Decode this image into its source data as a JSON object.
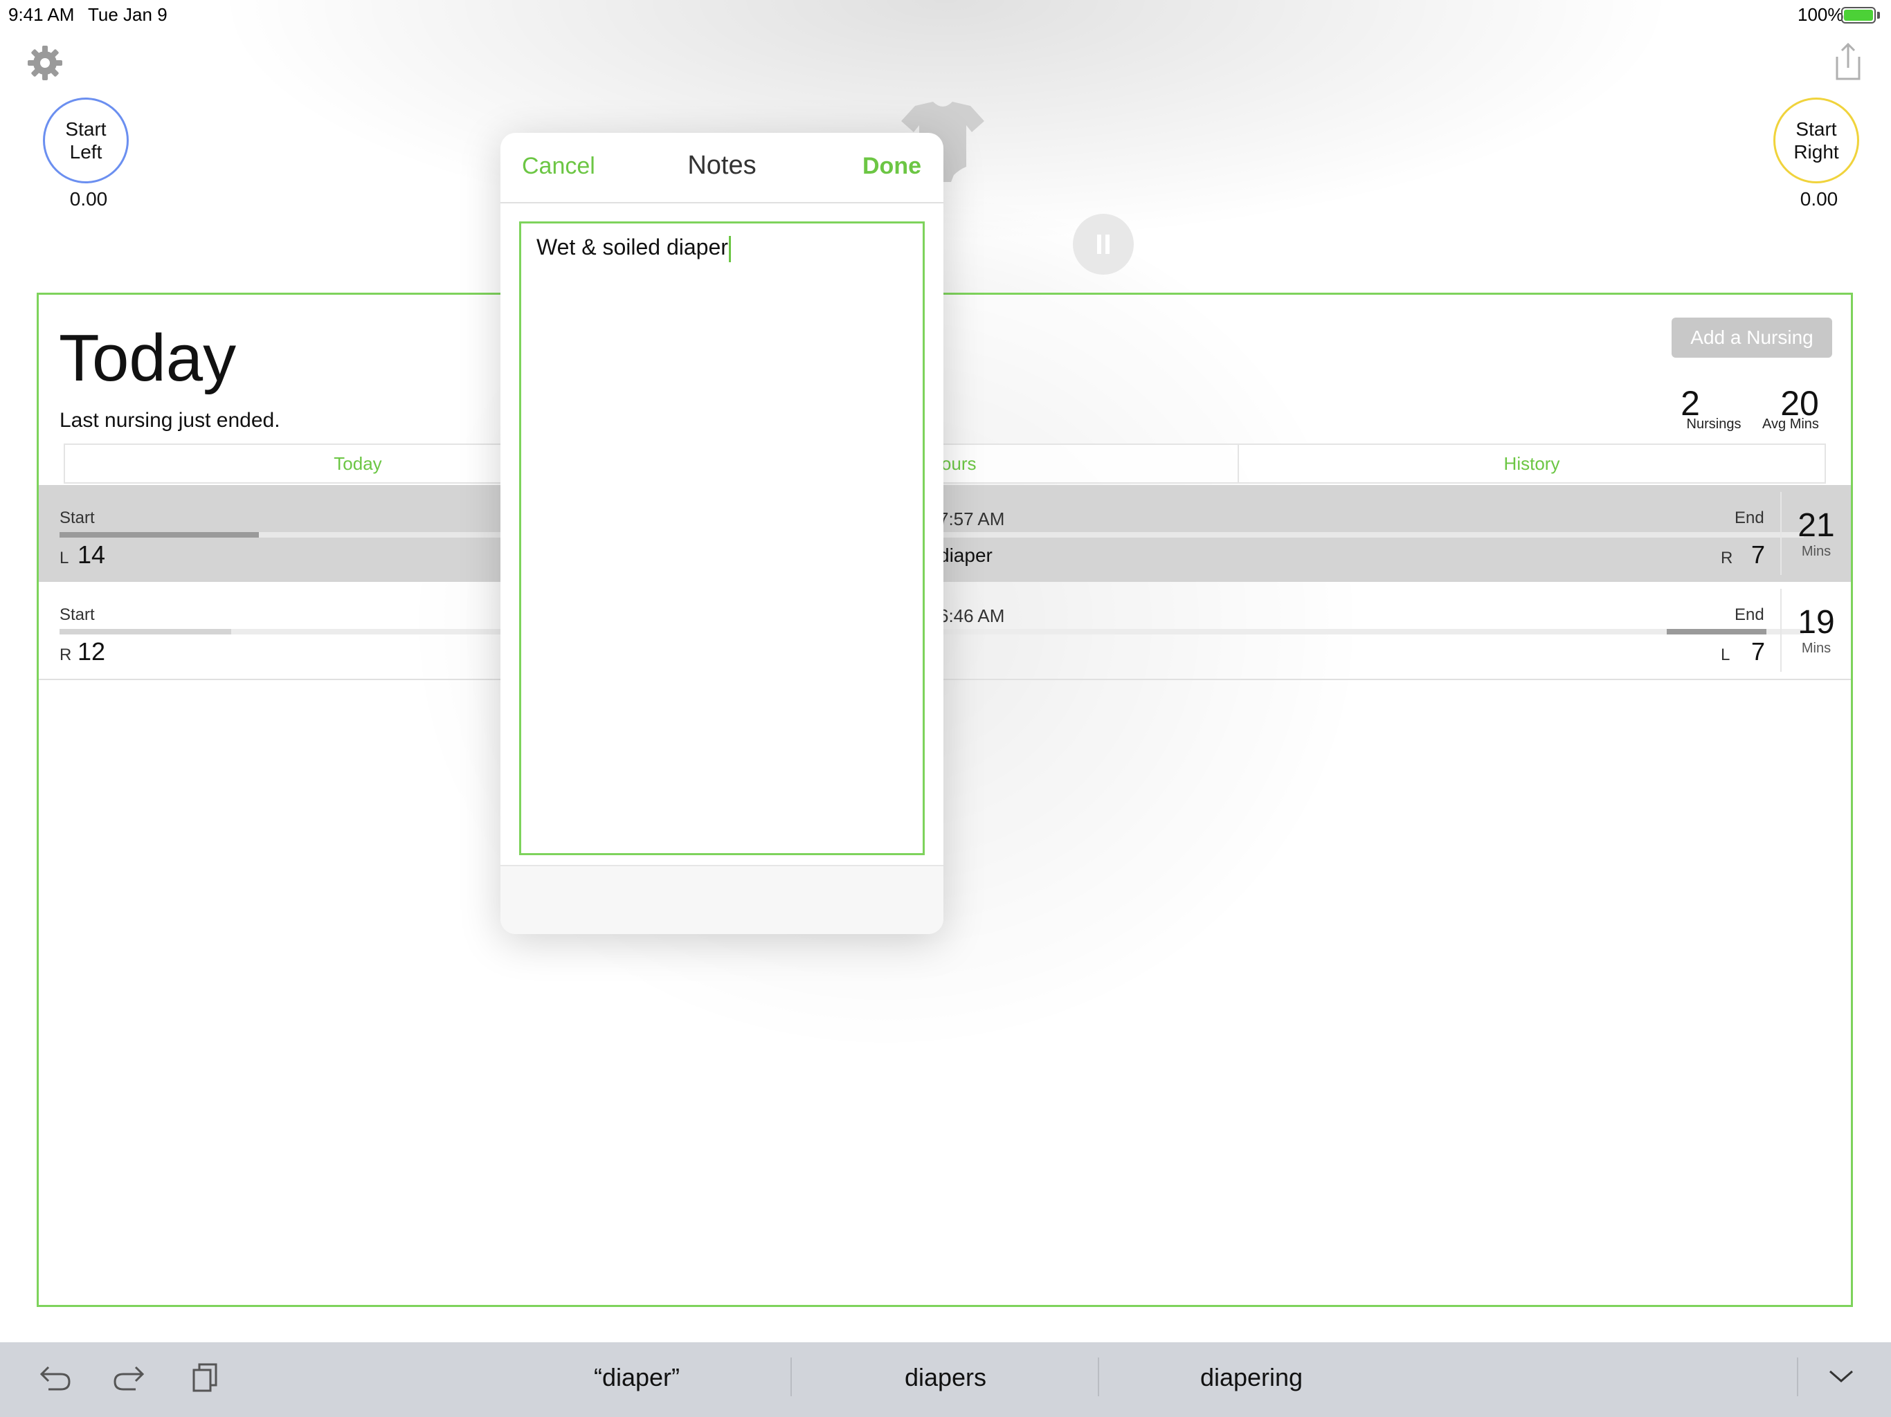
{
  "status_bar": {
    "time": "9:41 AM",
    "date": "Tue Jan 9",
    "battery": "100%"
  },
  "timers": {
    "left": {
      "line1": "Start",
      "line2": "Left",
      "elapsed": "0.00",
      "color": "#6b8ff0"
    },
    "right": {
      "line1": "Start",
      "line2": "Right",
      "elapsed": "0.00",
      "color": "#f0d33c"
    }
  },
  "summary": {
    "title": "Today",
    "subtitle": "Last nursing just ended.",
    "add_button": "Add a Nursing",
    "nursings_count": "2",
    "nursings_label": "Nursings",
    "avg_mins": "20",
    "avg_label": "Avg Mins"
  },
  "tabs": [
    {
      "label": "Today"
    },
    {
      "label": "4 Hours"
    },
    {
      "label": "History"
    }
  ],
  "sessions": [
    {
      "start_label": "Start",
      "start_side": "L",
      "start_mins": "14",
      "time": "7:57 AM",
      "note": "diaper",
      "end_label": "End",
      "end_side": "R",
      "end_mins": "7",
      "total": "21",
      "total_label": "Mins",
      "progress": 0.22
    },
    {
      "start_label": "Start",
      "start_side": "R",
      "start_mins": "12",
      "time": "6:46 AM",
      "note": "",
      "end_label": "End",
      "end_side": "L",
      "end_mins": "7",
      "total": "19",
      "total_label": "Mins",
      "progress": 0.19
    }
  ],
  "notes_modal": {
    "cancel": "Cancel",
    "title": "Notes",
    "done": "Done",
    "text": "Wet & soiled diaper"
  },
  "keyboard_bar": {
    "suggestions": [
      "“diaper”",
      "diapers",
      "diapering"
    ]
  },
  "colors": {
    "accent": "#6cc644",
    "border": "#7ed35c"
  }
}
